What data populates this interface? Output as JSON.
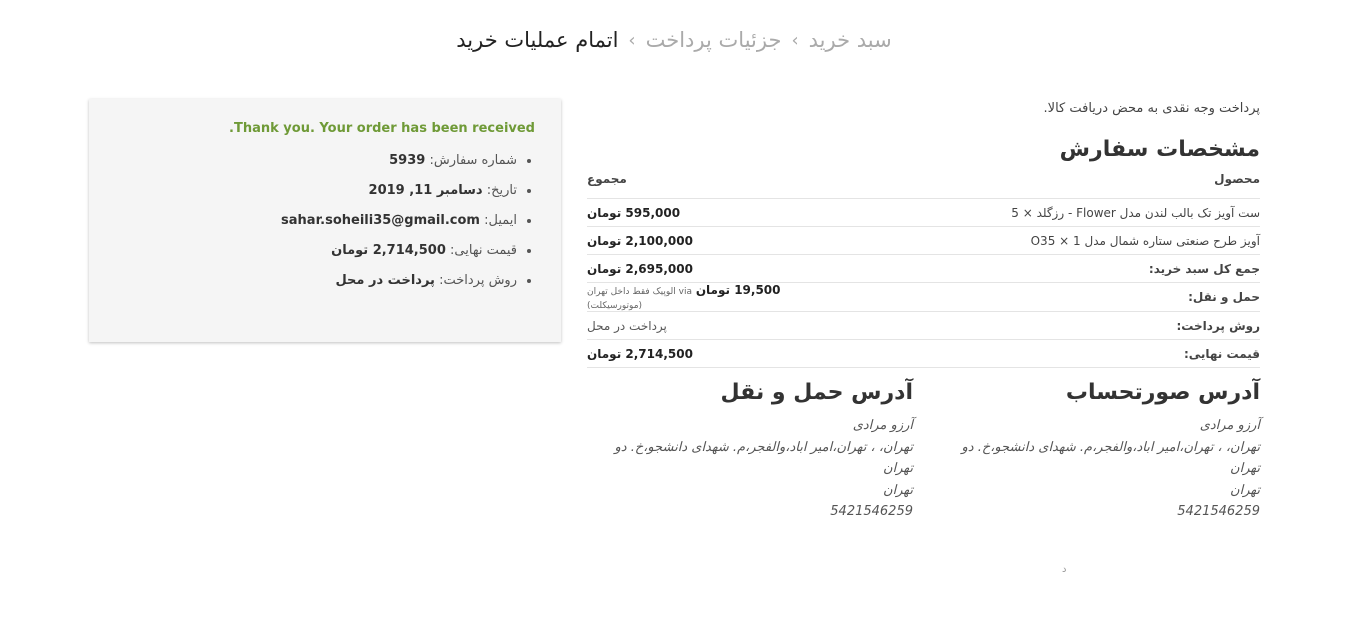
{
  "breadcrumb": {
    "cart": "سبد خرید",
    "sep1": "›",
    "payment": "جزئیات پرداخت",
    "sep2": "›",
    "complete": "اتمام عملیات خرید"
  },
  "receipt": {
    "thanks": "Thank you. Your order has been received.",
    "items": [
      {
        "label": "شماره سفارش:",
        "value": "5939"
      },
      {
        "label": "تاریخ:",
        "value": "دسامبر 11, 2019"
      },
      {
        "label": "ایمیل:",
        "value": "sahar.soheili35@gmail.com"
      },
      {
        "label": "قیمت نهایی:",
        "value": "2,714,500 تومان"
      },
      {
        "label": "روش پرداخت:",
        "value": "پرداخت در محل"
      }
    ]
  },
  "main": {
    "cash_note": "پرداخت وجه نقدی به محض دریافت کالا.",
    "order_title": "مشخصات سفارش",
    "table": {
      "col_product": "محصول",
      "col_total": "مجموع",
      "rows": [
        {
          "product": "ست آویز تک بالب لندن مدل Flower - رزگلد × 5",
          "total": "595,000 تومان"
        },
        {
          "product": "آویز طرح صنعتی ستاره شمال مدل 1 × O35",
          "total": "2,100,000 تومان"
        }
      ],
      "subtotal_label": "جمع کل سبد خرید:",
      "subtotal_value": "2,695,000 تومان",
      "shipping_label": "حمل و نقل:",
      "shipping_value": "19,500 تومان",
      "shipping_via": "via الوپیک فقط داخل تهران (موتورسیکلت)",
      "method_label": "روش پرداخت:",
      "method_value": "پرداخت در محل",
      "final_label": "قیمت نهایی:",
      "final_value": "2,714,500 تومان"
    }
  },
  "billing": {
    "title": "آدرس صورتحساب",
    "name": "آرزو مرادی",
    "street": "تهران، ، تهران،امیر اباد،والفجر،م. شهدای دانشجو،خ. دو",
    "city": "تهران",
    "state": "تهران",
    "phone": "5421546259"
  },
  "shipping": {
    "title": "آدرس حمل و نقل",
    "name": "آرزو مرادی",
    "street": "تهران، ، تهران،امیر اباد،والفجر،م. شهدای دانشجو،خ. دو",
    "city": "تهران",
    "state": "تهران",
    "phone": "5421546259"
  },
  "footer": {
    "stray_char": "د"
  }
}
